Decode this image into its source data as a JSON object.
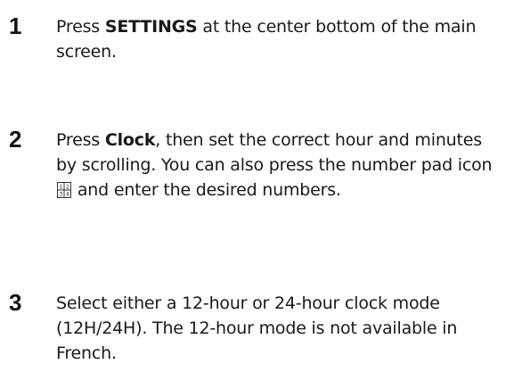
{
  "steps": [
    {
      "number": "1",
      "pre": "Press ",
      "bold": "SETTINGS",
      "post": " at the center bottom of the main screen."
    },
    {
      "number": "2",
      "pre": "Press ",
      "bold": "Clock",
      "post": ", then set the correct hour and minutes by scrolling. You can also press the number pad icon ",
      "icon": "number-pad-icon",
      "icon_digits": [
        "1",
        "2",
        "3",
        "4"
      ],
      "post2": " and enter the desired numbers."
    },
    {
      "number": "3",
      "text": "Select either a 12-hour or 24-hour clock mode (12H/24H). The 12-hour mode is not available in French."
    }
  ]
}
